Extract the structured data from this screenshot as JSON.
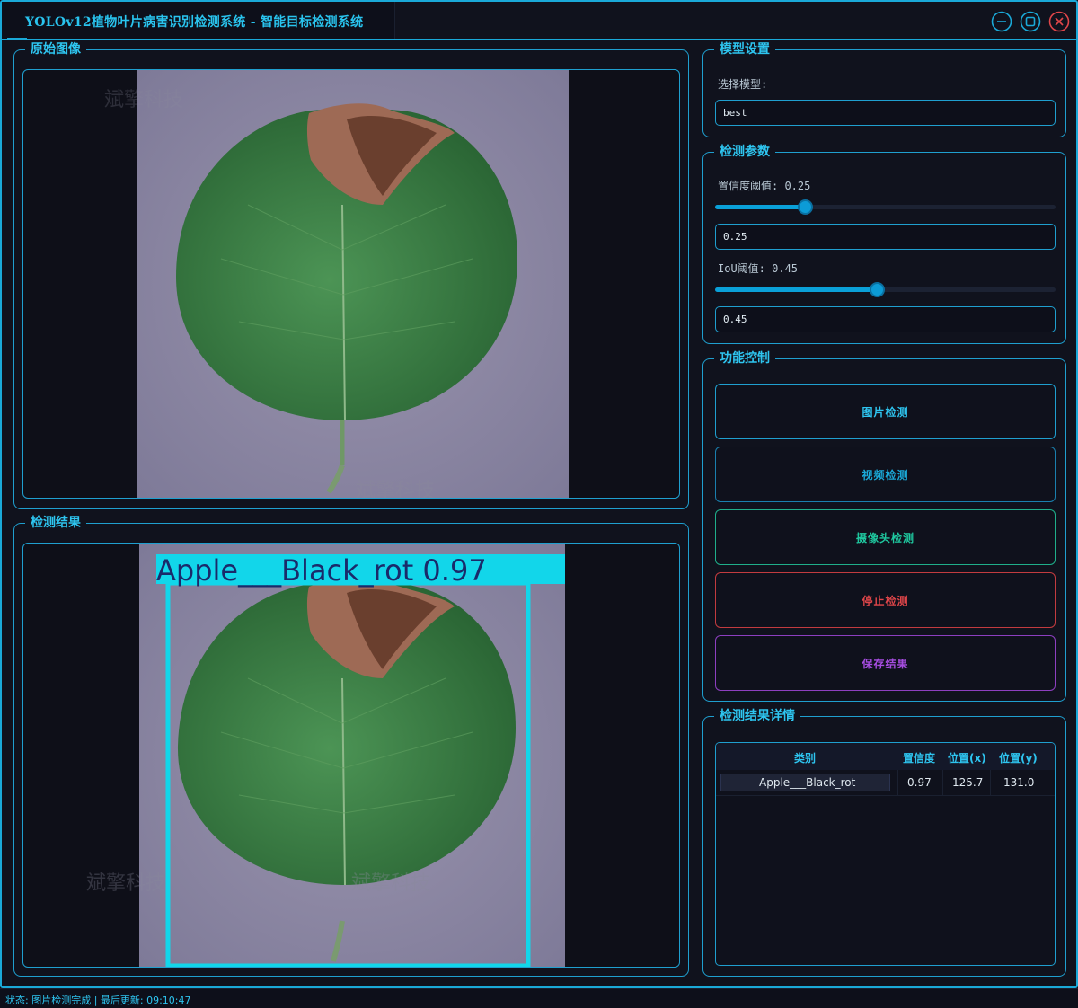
{
  "window": {
    "title": "YOLOv12植物叶片病害识别检测系统 - 智能目标检测系统"
  },
  "panels": {
    "original": {
      "title": "原始图像"
    },
    "result": {
      "title": "检测结果"
    },
    "model": {
      "title": "模型设置",
      "select_label": "选择模型:",
      "selected_model": "best"
    },
    "params": {
      "title": "检测参数",
      "conf_label": "置信度阈值: 0.25",
      "conf_value": "0.25",
      "conf_level": 0.25,
      "iou_label": "IoU阈值: 0.45",
      "iou_value": "0.45",
      "iou_level": 0.45
    },
    "controls": {
      "title": "功能控制",
      "image_detect": "图片检测",
      "video_detect": "视频检测",
      "camera_detect": "摄像头检测",
      "stop_detect": "停止检测",
      "save_result": "保存结果"
    },
    "details": {
      "title": "检测结果详情",
      "columns": [
        "类别",
        "置信度",
        "位置(x)",
        "位置(y)"
      ],
      "rows": [
        [
          "Apple___Black_rot",
          "0.97",
          "125.7",
          "131.0"
        ]
      ]
    }
  },
  "detection": {
    "label": "Apple___Black_rot 0.97"
  },
  "watermark": "斌擎科技",
  "status": {
    "text": "状态: 图片检测完成 | 最后更新: 09:10:47"
  },
  "colors": {
    "accent": "#1aa9d8",
    "title_text": "#2ec5f0",
    "video_btn": "#1aa9d8",
    "camera_btn": "#1fc9a0",
    "stop_btn": "#e0464a",
    "save_btn": "#a64de0",
    "bbox": "#12d6ea"
  },
  "icons": {
    "minimize": "minimize-icon",
    "maximize": "maximize-icon",
    "close": "close-icon"
  }
}
